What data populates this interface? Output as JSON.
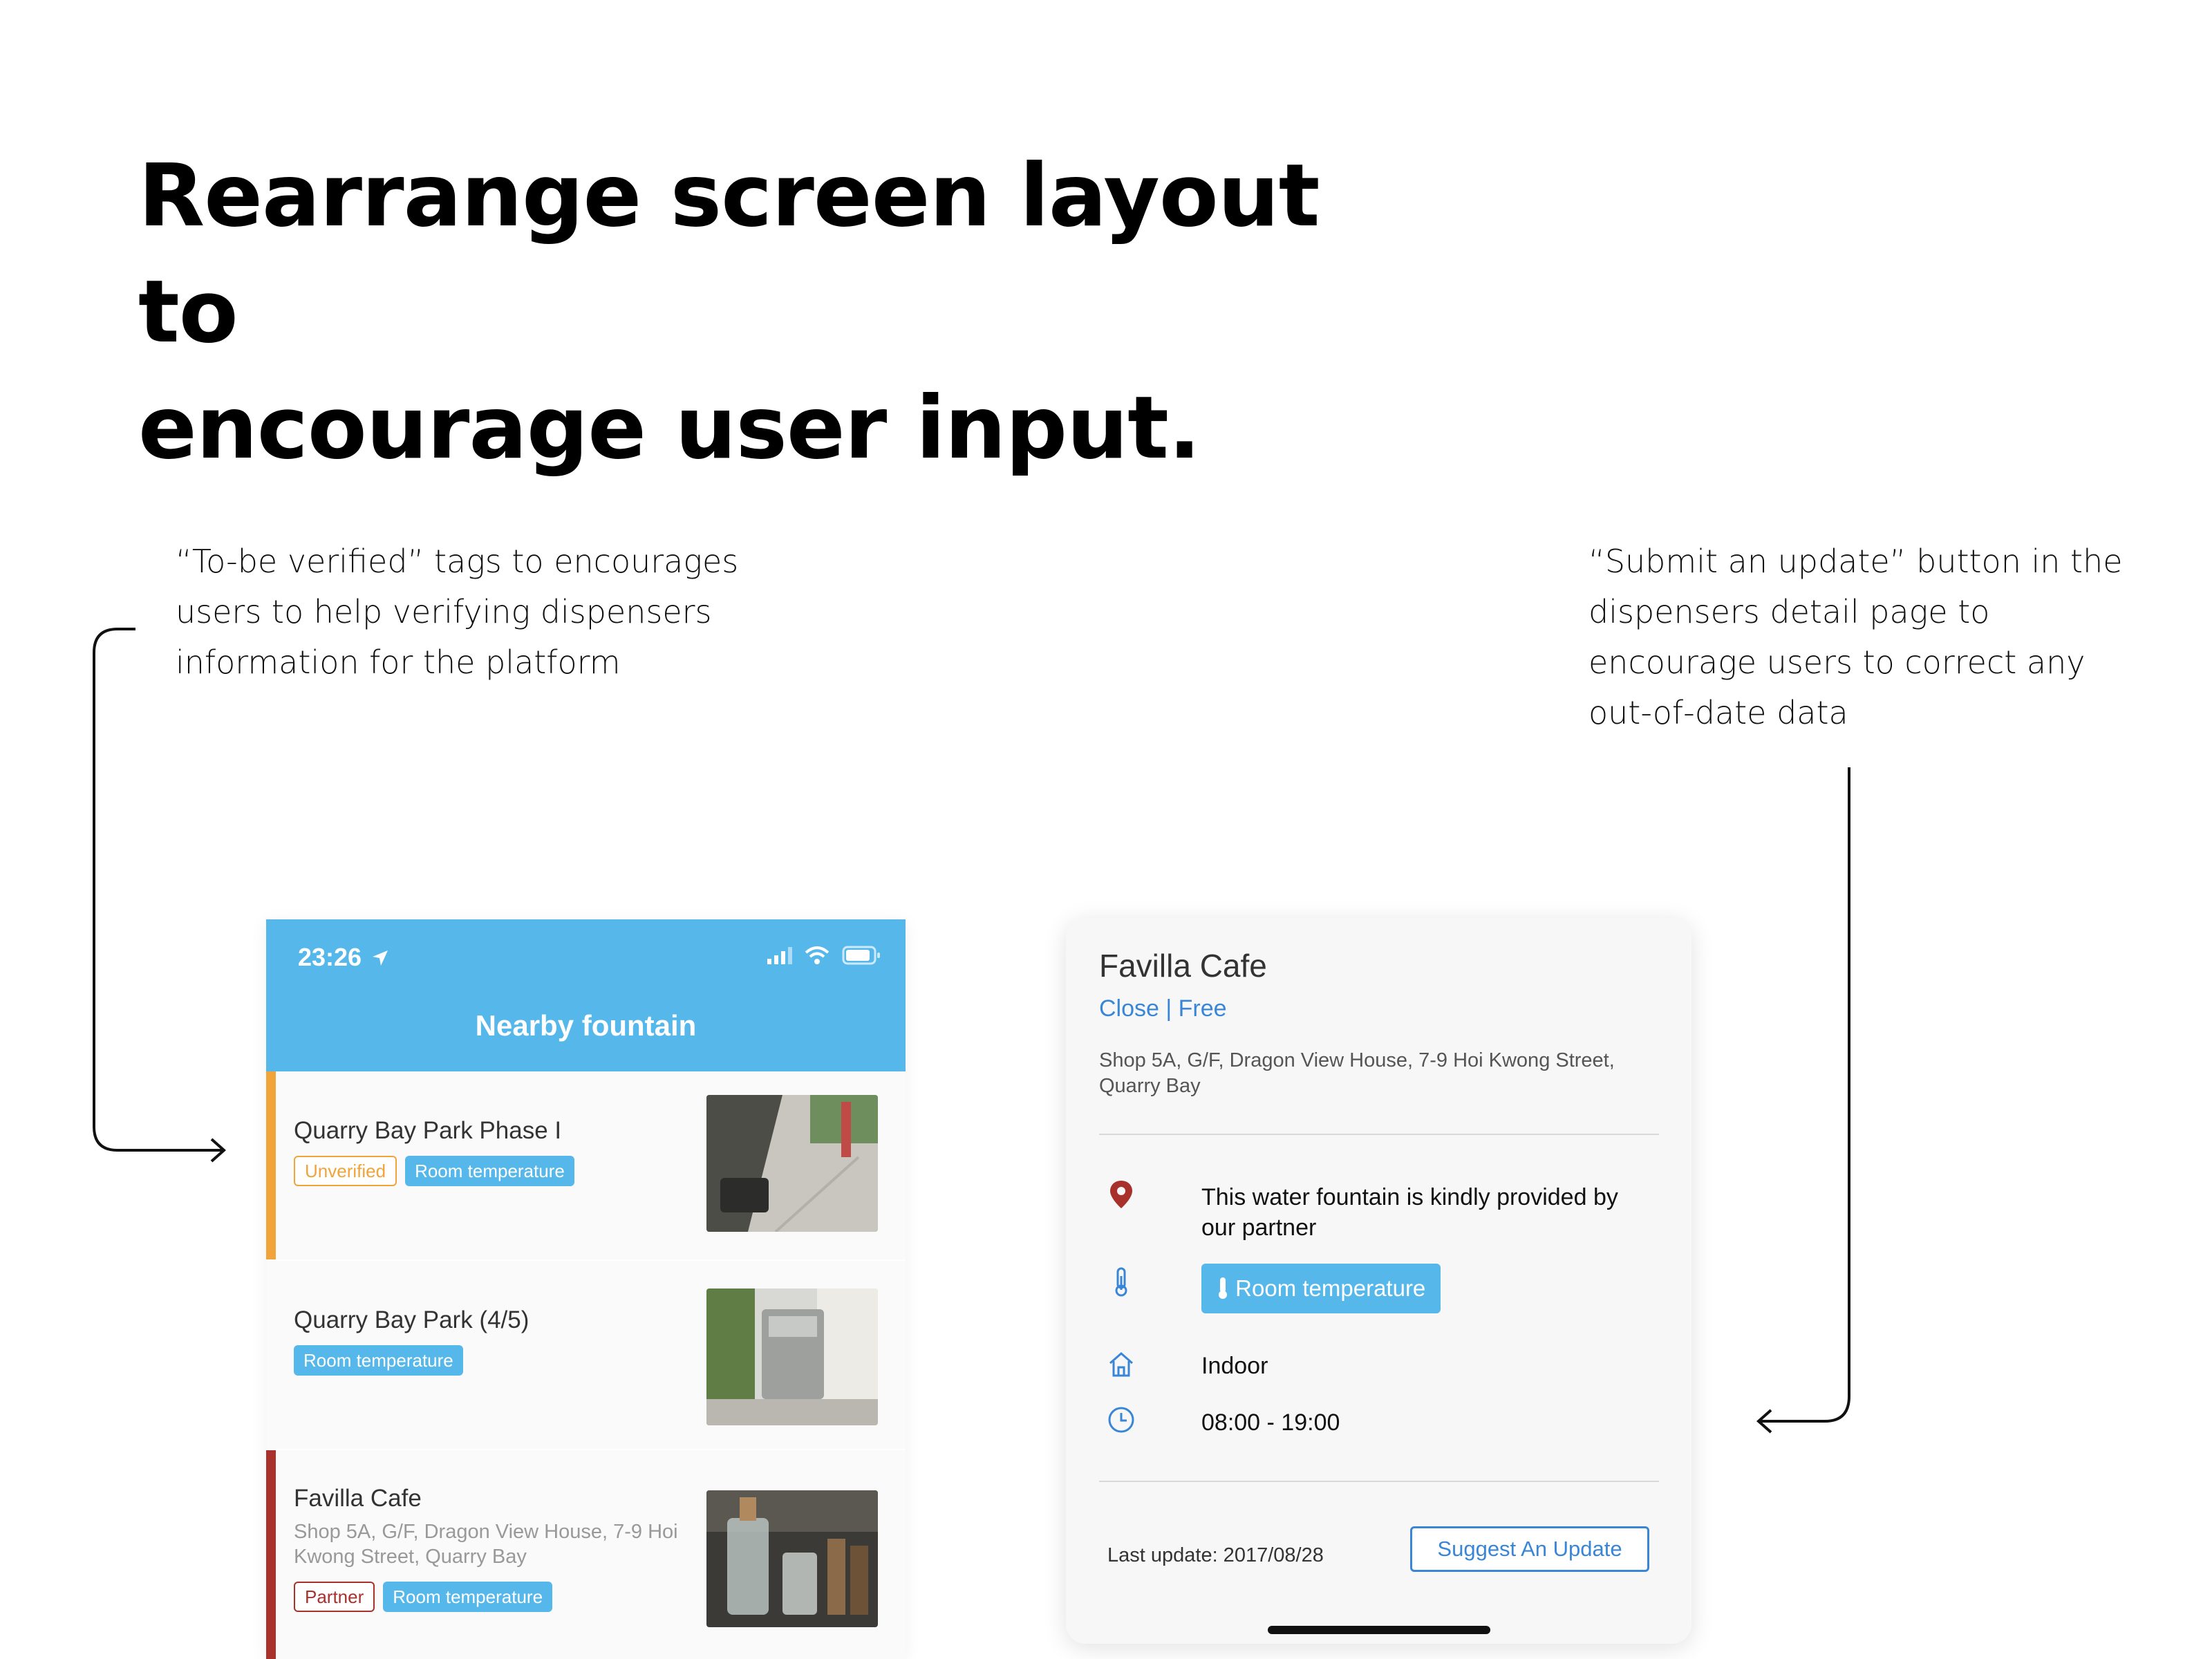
{
  "headline": {
    "line1": "Rearrange screen layout to",
    "line2": "encourage user input."
  },
  "notes": {
    "left": [
      "“To-be verified” tags to encourages",
      "users to help verifying dispensers",
      "information for the platform"
    ],
    "right": [
      "“Submit an update” button in the",
      "dispensers detail page to",
      "encourage users to correct any",
      "out-of-date data"
    ]
  },
  "phone": {
    "time": "23:26",
    "nav_title": "Nearby fountain",
    "items": [
      {
        "title": "Quarry Bay Park Phase I",
        "address": "",
        "tags": [
          "Unverified",
          "Room temperature"
        ],
        "accent": "#f0a43a"
      },
      {
        "title": "Quarry Bay Park (4/5)",
        "address": "",
        "tags": [
          "Room temperature"
        ],
        "accent": ""
      },
      {
        "title": "Favilla Cafe",
        "address": "Shop 5A, G/F, Dragon View House, 7-9 Hoi Kwong Street, Quarry Bay",
        "tags": [
          "Partner",
          "Room temperature"
        ],
        "accent": "#a8322b"
      }
    ]
  },
  "detail": {
    "title": "Favilla Cafe",
    "status": "Close | Free",
    "address": "Shop 5A, G/F, Dragon View House, 7-9 Hoi Kwong Street, Quarry Bay",
    "partner_text": "This water fountain is kindly provided by our partner",
    "temperature_tag": "Room temperature",
    "location_type": "Indoor",
    "hours": "08:00 - 19:00",
    "last_update": "Last update: 2017/08/28",
    "suggest_button": "Suggest An Update"
  },
  "colors": {
    "brand_blue": "#56b7ea",
    "link_blue": "#3a86d6",
    "unverified_orange": "#f0a43a",
    "partner_red": "#a8322b"
  }
}
